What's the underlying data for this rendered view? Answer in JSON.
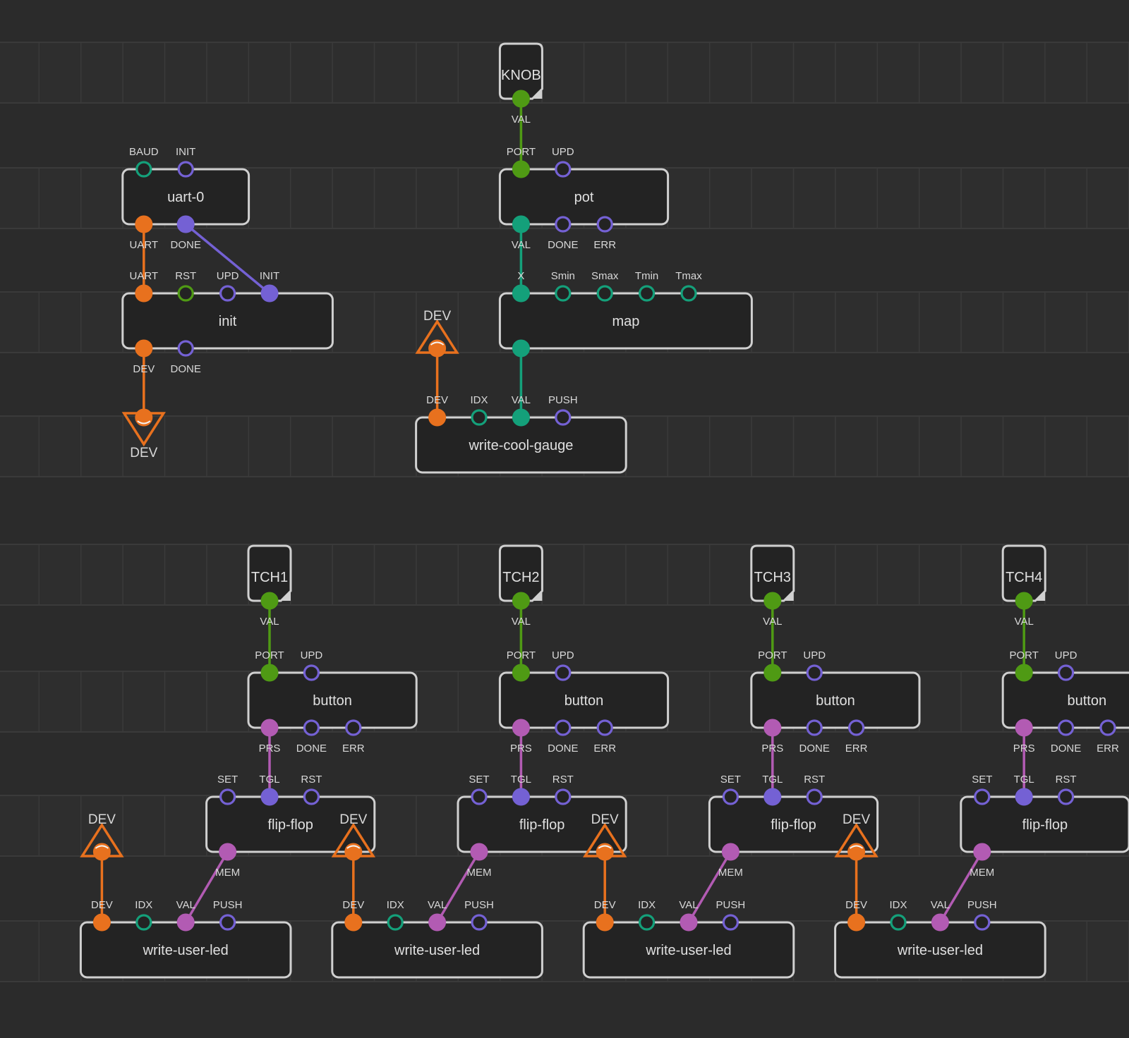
{
  "colors": {
    "background": "#2b2b2b",
    "device": "#e8711e",
    "number": "#14a07a",
    "pulse": "#7461d4",
    "boolean": "#4f9a14",
    "byte": "#b25bb3",
    "node_border": "#d0d0d0",
    "node_fill": "#232323"
  },
  "nodes": [
    {
      "id": "knob",
      "kind": "terminal",
      "title": "KNOB",
      "outputs": [
        {
          "label": "VAL",
          "type": "boolean",
          "filled": true
        }
      ]
    },
    {
      "id": "uart0",
      "kind": "node",
      "title": "uart-0",
      "inputs": [
        {
          "label": "BAUD",
          "type": "number",
          "filled": false
        },
        {
          "label": "INIT",
          "type": "pulse",
          "filled": false
        }
      ],
      "outputs": [
        {
          "label": "UART",
          "type": "device",
          "filled": true
        },
        {
          "label": "DONE",
          "type": "pulse",
          "filled": true
        }
      ]
    },
    {
      "id": "init",
      "kind": "node",
      "title": "init",
      "inputs": [
        {
          "label": "UART",
          "type": "device",
          "filled": true
        },
        {
          "label": "RST",
          "type": "boolean",
          "filled": false
        },
        {
          "label": "UPD",
          "type": "pulse",
          "filled": false
        },
        {
          "label": "INIT",
          "type": "pulse",
          "filled": true
        }
      ],
      "outputs": [
        {
          "label": "DEV",
          "type": "device",
          "filled": true
        },
        {
          "label": "DONE",
          "type": "pulse",
          "filled": false
        }
      ]
    },
    {
      "id": "pot",
      "kind": "node",
      "title": "pot",
      "inputs": [
        {
          "label": "PORT",
          "type": "boolean",
          "filled": true
        },
        {
          "label": "UPD",
          "type": "pulse",
          "filled": false
        }
      ],
      "outputs": [
        {
          "label": "VAL",
          "type": "number",
          "filled": true
        },
        {
          "label": "DONE",
          "type": "pulse",
          "filled": false
        },
        {
          "label": "ERR",
          "type": "pulse",
          "filled": false
        }
      ]
    },
    {
      "id": "map",
      "kind": "node",
      "title": "map",
      "inputs": [
        {
          "label": "X",
          "type": "number",
          "filled": true
        },
        {
          "label": "Smin",
          "type": "number",
          "filled": false
        },
        {
          "label": "Smax",
          "type": "number",
          "filled": false
        },
        {
          "label": "Tmin",
          "type": "number",
          "filled": false
        },
        {
          "label": "Tmax",
          "type": "number",
          "filled": false
        }
      ],
      "outputs": [
        {
          "label": "",
          "type": "number",
          "filled": true
        }
      ]
    },
    {
      "id": "wcg",
      "kind": "node",
      "title": "write-cool-gauge",
      "inputs": [
        {
          "label": "DEV",
          "type": "device",
          "filled": true
        },
        {
          "label": "IDX",
          "type": "number",
          "filled": false
        },
        {
          "label": "VAL",
          "type": "number",
          "filled": true
        },
        {
          "label": "PUSH",
          "type": "pulse",
          "filled": false
        }
      ],
      "outputs": []
    },
    {
      "id": "bus_out",
      "kind": "bus-out",
      "title": "DEV"
    },
    {
      "id": "bus_in0",
      "kind": "bus-in",
      "title": "DEV"
    },
    {
      "id": "tch1",
      "kind": "terminal",
      "title": "TCH1",
      "outputs": [
        {
          "label": "VAL",
          "type": "boolean",
          "filled": true
        }
      ]
    },
    {
      "id": "btn1",
      "kind": "node",
      "title": "button",
      "inputs": [
        {
          "label": "PORT",
          "type": "boolean",
          "filled": true
        },
        {
          "label": "UPD",
          "type": "pulse",
          "filled": false
        }
      ],
      "outputs": [
        {
          "label": "PRS",
          "type": "byte",
          "filled": true
        },
        {
          "label": "DONE",
          "type": "pulse",
          "filled": false
        },
        {
          "label": "ERR",
          "type": "pulse",
          "filled": false
        }
      ]
    },
    {
      "id": "ff1",
      "kind": "node",
      "title": "flip-flop",
      "inputs": [
        {
          "label": "SET",
          "type": "pulse",
          "filled": false
        },
        {
          "label": "TGL",
          "type": "pulse",
          "filled": true
        },
        {
          "label": "RST",
          "type": "pulse",
          "filled": false
        }
      ],
      "outputs": [
        {
          "label": "MEM",
          "type": "byte",
          "filled": true
        }
      ]
    },
    {
      "id": "wul1",
      "kind": "node",
      "title": "write-user-led",
      "inputs": [
        {
          "label": "DEV",
          "type": "device",
          "filled": true
        },
        {
          "label": "IDX",
          "type": "number",
          "filled": false
        },
        {
          "label": "VAL",
          "type": "byte",
          "filled": true
        },
        {
          "label": "PUSH",
          "type": "pulse",
          "filled": false
        }
      ],
      "outputs": []
    },
    {
      "id": "bus1",
      "kind": "bus-in",
      "title": "DEV"
    },
    {
      "id": "tch2",
      "kind": "terminal",
      "title": "TCH2",
      "outputs": [
        {
          "label": "VAL",
          "type": "boolean",
          "filled": true
        }
      ]
    },
    {
      "id": "btn2",
      "kind": "node",
      "title": "button",
      "inputs": [
        {
          "label": "PORT",
          "type": "boolean",
          "filled": true
        },
        {
          "label": "UPD",
          "type": "pulse",
          "filled": false
        }
      ],
      "outputs": [
        {
          "label": "PRS",
          "type": "byte",
          "filled": true
        },
        {
          "label": "DONE",
          "type": "pulse",
          "filled": false
        },
        {
          "label": "ERR",
          "type": "pulse",
          "filled": false
        }
      ]
    },
    {
      "id": "ff2",
      "kind": "node",
      "title": "flip-flop",
      "inputs": [
        {
          "label": "SET",
          "type": "pulse",
          "filled": false
        },
        {
          "label": "TGL",
          "type": "pulse",
          "filled": true
        },
        {
          "label": "RST",
          "type": "pulse",
          "filled": false
        }
      ],
      "outputs": [
        {
          "label": "MEM",
          "type": "byte",
          "filled": true
        }
      ]
    },
    {
      "id": "wul2",
      "kind": "node",
      "title": "write-user-led",
      "inputs": [
        {
          "label": "DEV",
          "type": "device",
          "filled": true
        },
        {
          "label": "IDX",
          "type": "number",
          "filled": false
        },
        {
          "label": "VAL",
          "type": "byte",
          "filled": true
        },
        {
          "label": "PUSH",
          "type": "pulse",
          "filled": false
        }
      ],
      "outputs": []
    },
    {
      "id": "bus2",
      "kind": "bus-in",
      "title": "DEV"
    },
    {
      "id": "tch3",
      "kind": "terminal",
      "title": "TCH3",
      "outputs": [
        {
          "label": "VAL",
          "type": "boolean",
          "filled": true
        }
      ]
    },
    {
      "id": "btn3",
      "kind": "node",
      "title": "button",
      "inputs": [
        {
          "label": "PORT",
          "type": "boolean",
          "filled": true
        },
        {
          "label": "UPD",
          "type": "pulse",
          "filled": false
        }
      ],
      "outputs": [
        {
          "label": "PRS",
          "type": "byte",
          "filled": true
        },
        {
          "label": "DONE",
          "type": "pulse",
          "filled": false
        },
        {
          "label": "ERR",
          "type": "pulse",
          "filled": false
        }
      ]
    },
    {
      "id": "ff3",
      "kind": "node",
      "title": "flip-flop",
      "inputs": [
        {
          "label": "SET",
          "type": "pulse",
          "filled": false
        },
        {
          "label": "TGL",
          "type": "pulse",
          "filled": true
        },
        {
          "label": "RST",
          "type": "pulse",
          "filled": false
        }
      ],
      "outputs": [
        {
          "label": "MEM",
          "type": "byte",
          "filled": true
        }
      ]
    },
    {
      "id": "wul3",
      "kind": "node",
      "title": "write-user-led",
      "inputs": [
        {
          "label": "DEV",
          "type": "device",
          "filled": true
        },
        {
          "label": "IDX",
          "type": "number",
          "filled": false
        },
        {
          "label": "VAL",
          "type": "byte",
          "filled": true
        },
        {
          "label": "PUSH",
          "type": "pulse",
          "filled": false
        }
      ],
      "outputs": []
    },
    {
      "id": "bus3",
      "kind": "bus-in",
      "title": "DEV"
    },
    {
      "id": "tch4",
      "kind": "terminal",
      "title": "TCH4",
      "outputs": [
        {
          "label": "VAL",
          "type": "boolean",
          "filled": true
        }
      ]
    },
    {
      "id": "btn4",
      "kind": "node",
      "title": "button",
      "inputs": [
        {
          "label": "PORT",
          "type": "boolean",
          "filled": true
        },
        {
          "label": "UPD",
          "type": "pulse",
          "filled": false
        }
      ],
      "outputs": [
        {
          "label": "PRS",
          "type": "byte",
          "filled": true
        },
        {
          "label": "DONE",
          "type": "pulse",
          "filled": false
        },
        {
          "label": "ERR",
          "type": "pulse",
          "filled": false
        }
      ]
    },
    {
      "id": "ff4",
      "kind": "node",
      "title": "flip-flop",
      "inputs": [
        {
          "label": "SET",
          "type": "pulse",
          "filled": false
        },
        {
          "label": "TGL",
          "type": "pulse",
          "filled": true
        },
        {
          "label": "RST",
          "type": "pulse",
          "filled": false
        }
      ],
      "outputs": [
        {
          "label": "MEM",
          "type": "byte",
          "filled": true
        }
      ]
    },
    {
      "id": "wul4",
      "kind": "node",
      "title": "write-user-led",
      "inputs": [
        {
          "label": "DEV",
          "type": "device",
          "filled": true
        },
        {
          "label": "IDX",
          "type": "number",
          "filled": false
        },
        {
          "label": "VAL",
          "type": "byte",
          "filled": true
        },
        {
          "label": "PUSH",
          "type": "pulse",
          "filled": false
        }
      ],
      "outputs": []
    },
    {
      "id": "bus4",
      "kind": "bus-in",
      "title": "DEV"
    }
  ],
  "links": [
    {
      "from": "knob.VAL",
      "to": "pot.PORT",
      "type": "boolean"
    },
    {
      "from": "uart0.UART",
      "to": "init.UART",
      "type": "device"
    },
    {
      "from": "uart0.DONE",
      "to": "init.INIT",
      "type": "pulse"
    },
    {
      "from": "init.DEV",
      "to": "bus_out",
      "type": "device"
    },
    {
      "from": "pot.VAL",
      "to": "map.X",
      "type": "number"
    },
    {
      "from": "map.out",
      "to": "wcg.VAL",
      "type": "number"
    },
    {
      "from": "bus_in0",
      "to": "wcg.DEV",
      "type": "device"
    },
    {
      "from": "tch1.VAL",
      "to": "btn1.PORT",
      "type": "boolean"
    },
    {
      "from": "btn1.PRS",
      "to": "ff1.TGL",
      "type": "byte"
    },
    {
      "from": "ff1.MEM",
      "to": "wul1.VAL",
      "type": "byte"
    },
    {
      "from": "bus1",
      "to": "wul1.DEV",
      "type": "device"
    },
    {
      "from": "tch2.VAL",
      "to": "btn2.PORT",
      "type": "boolean"
    },
    {
      "from": "btn2.PRS",
      "to": "ff2.TGL",
      "type": "byte"
    },
    {
      "from": "ff2.MEM",
      "to": "wul2.VAL",
      "type": "byte"
    },
    {
      "from": "bus2",
      "to": "wul2.DEV",
      "type": "device"
    },
    {
      "from": "tch3.VAL",
      "to": "btn3.PORT",
      "type": "boolean"
    },
    {
      "from": "btn3.PRS",
      "to": "ff3.TGL",
      "type": "byte"
    },
    {
      "from": "ff3.MEM",
      "to": "wul3.VAL",
      "type": "byte"
    },
    {
      "from": "bus3",
      "to": "wul3.DEV",
      "type": "device"
    },
    {
      "from": "tch4.VAL",
      "to": "btn4.PORT",
      "type": "boolean"
    },
    {
      "from": "btn4.PRS",
      "to": "ff4.TGL",
      "type": "byte"
    },
    {
      "from": "ff4.MEM",
      "to": "wul4.VAL",
      "type": "byte"
    },
    {
      "from": "bus4",
      "to": "wul4.DEV",
      "type": "device"
    }
  ]
}
